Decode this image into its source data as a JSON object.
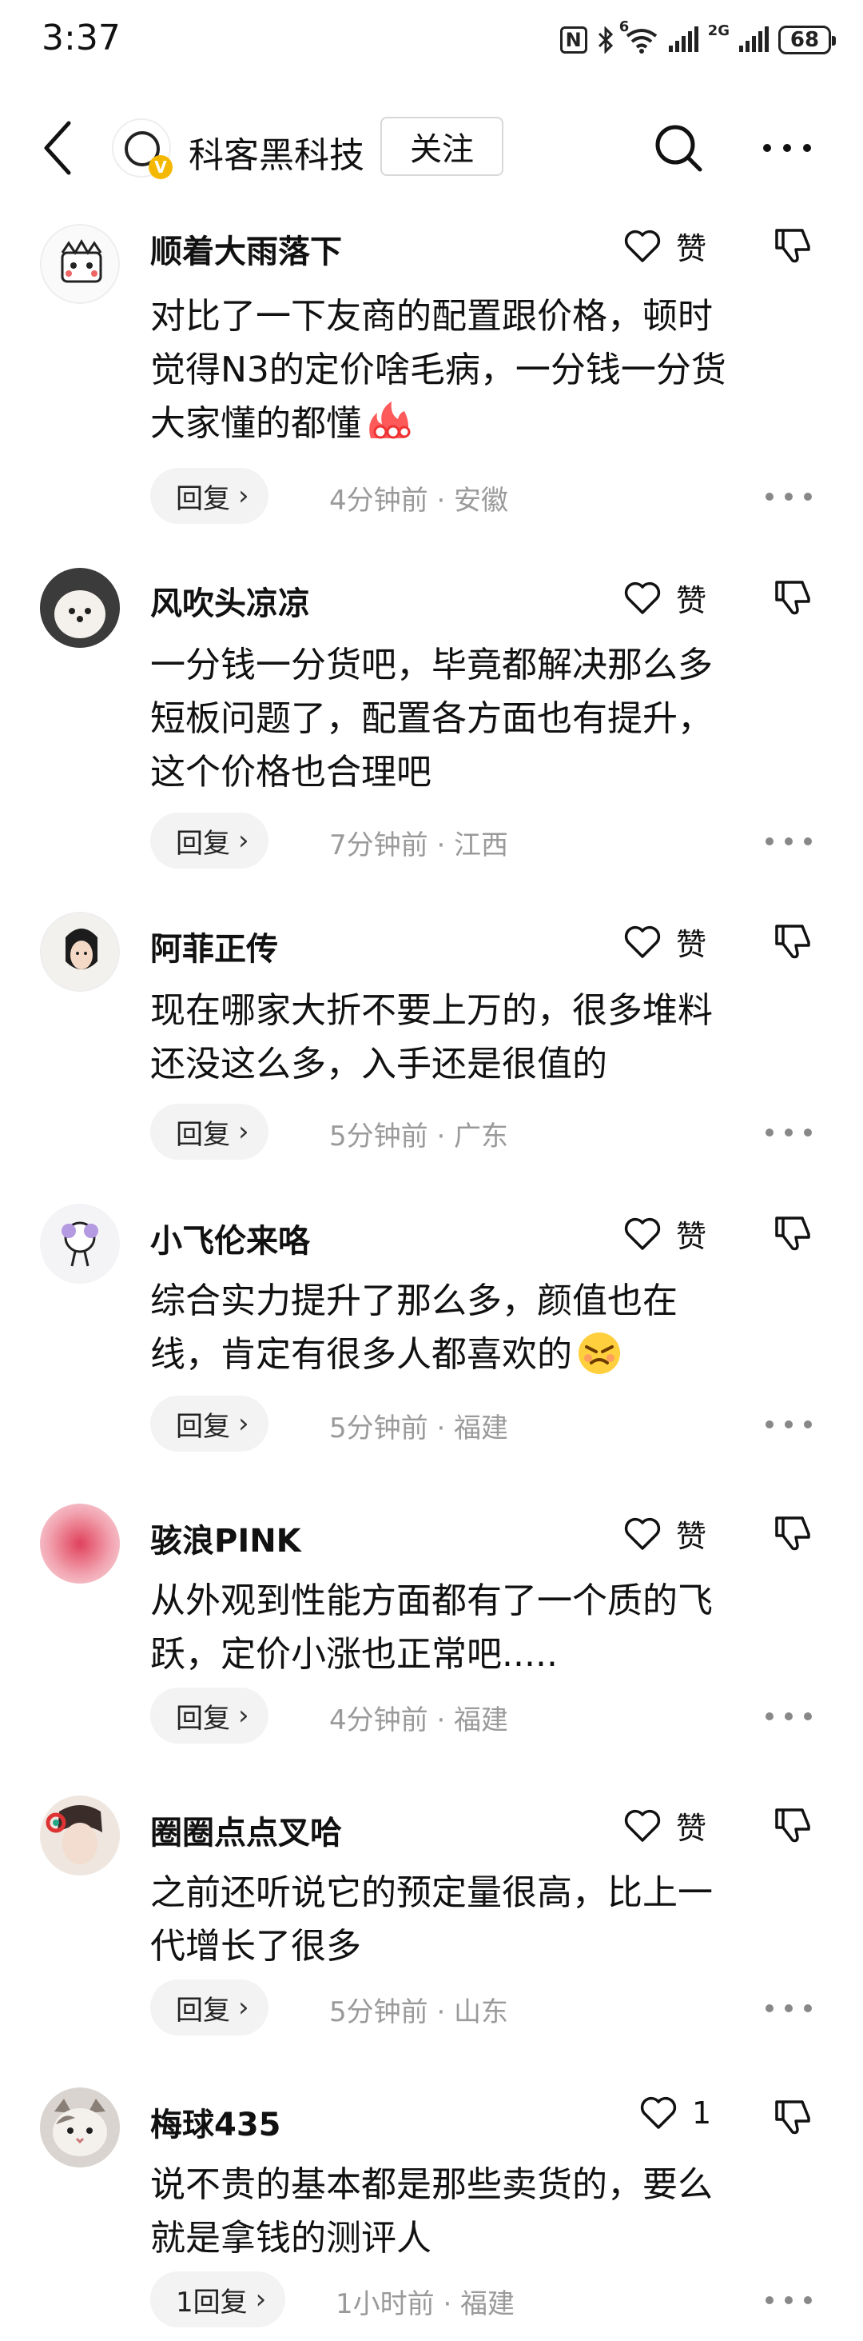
{
  "status_bar": {
    "time": "3:37",
    "nfc": "N",
    "network": "2G",
    "wifi_badge": "6",
    "battery": "68"
  },
  "header": {
    "account_name": "科客黑科技",
    "follow_label": "关注",
    "verified_badge": "V"
  },
  "like_label": "赞",
  "comments": [
    {
      "username": "顺着大雨落下",
      "text_lines": [
        "对比了一下友商的配置跟价格，顿时",
        "觉得N3的定价啥毛病，一分钱一分货",
        "大家懂的都懂"
      ],
      "emoji": "fire-emoji",
      "likes": "赞",
      "reply_label": "回复",
      "meta": "4分钟前 · 安徽"
    },
    {
      "username": "风吹头凉凉",
      "text_lines": [
        "一分钱一分货吧，毕竟都解决那么多",
        "短板问题了，配置各方面也有提升，",
        "这个价格也合理吧"
      ],
      "likes": "赞",
      "reply_label": "回复",
      "meta": "7分钟前 · 江西"
    },
    {
      "username": "阿菲正传",
      "text_lines": [
        "现在哪家大折不要上万的，很多堆料",
        "还没这么多，入手还是很值的"
      ],
      "likes": "赞",
      "reply_label": "回复",
      "meta": "5分钟前 · 广东"
    },
    {
      "username": "小飞伦来咯",
      "text_lines": [
        "综合实力提升了那么多，颜值也在",
        "线，肯定有很多人都喜欢的"
      ],
      "emoji": "angry-face-emoji",
      "likes": "赞",
      "reply_label": "回复",
      "meta": "5分钟前 · 福建"
    },
    {
      "username": "骇浪PINK",
      "text_lines": [
        "从外观到性能方面都有了一个质的飞",
        "跃，定价小涨也正常吧....."
      ],
      "likes": "赞",
      "reply_label": "回复",
      "meta": "4分钟前 · 福建"
    },
    {
      "username": "圈圈点点叉哈",
      "text_lines": [
        "之前还听说它的预定量很高，比上一",
        "代增长了很多"
      ],
      "likes": "赞",
      "reply_label": "回复",
      "meta": "5分钟前 · 山东"
    },
    {
      "username": "梅球435",
      "text_lines": [
        "说不贵的基本都是那些卖货的，要么",
        "就是拿钱的测评人"
      ],
      "likes": "1",
      "reply_label": "1回复",
      "meta": "1小时前 · 福建"
    }
  ],
  "colors": {
    "text": "#111111",
    "meta": "#9a9a9a",
    "reply_bg": "#f3f3f3",
    "verified": "#f5b800"
  }
}
